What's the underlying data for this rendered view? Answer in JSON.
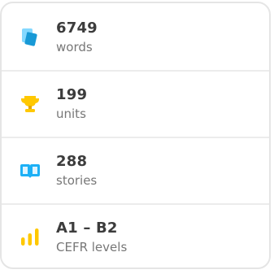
{
  "stats": [
    {
      "value": "6749",
      "label": "words",
      "icon": "cards-icon",
      "color": "#1cb0f6"
    },
    {
      "value": "199",
      "label": "units",
      "icon": "trophy-icon",
      "color": "#ffc800"
    },
    {
      "value": "288",
      "label": "stories",
      "icon": "book-icon",
      "color": "#1cb0f6"
    },
    {
      "value": "A1 – B2",
      "label": "CEFR levels",
      "icon": "level-bars-icon",
      "color": "#ffc800"
    }
  ]
}
